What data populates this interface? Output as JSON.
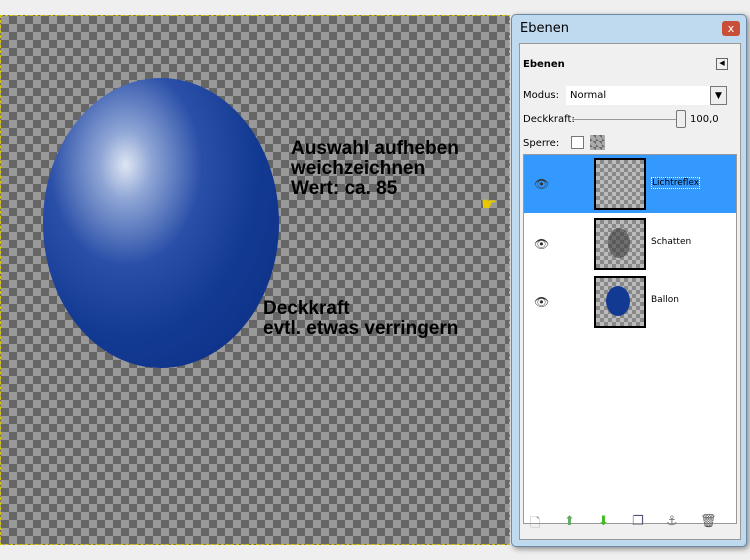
{
  "canvas": {
    "notes": [
      "Auswahl aufheben",
      "weichzeichnen",
      "Wert: ca. 85",
      "Deckkraft",
      "evtl. etwas verringern"
    ]
  },
  "dialog": {
    "title": "Ebenen",
    "close": "x",
    "section": "Ebenen",
    "mode_label": "Modus:",
    "mode_value": "Normal",
    "opacity_label": "Deckkraft:",
    "opacity_value": "100,0",
    "lock_label": "Sperre:",
    "layers": [
      {
        "name": "Lichtreflex",
        "active": true
      },
      {
        "name": "Schatten",
        "active": false
      },
      {
        "name": "Ballon",
        "active": false
      }
    ]
  },
  "colors": {
    "selection": "#3399ff",
    "balloon": "#133a93"
  }
}
